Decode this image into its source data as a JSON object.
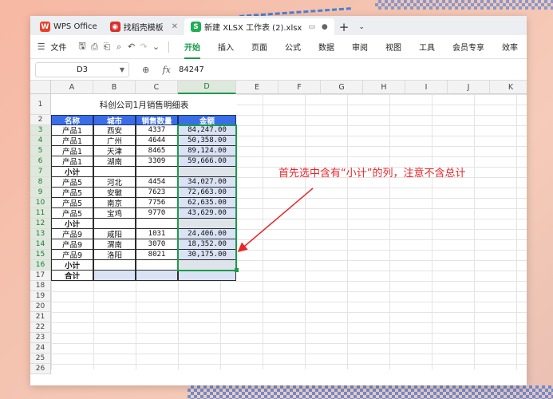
{
  "tabs": [
    {
      "label": "WPS Office",
      "icon": "wps-logo-icon"
    },
    {
      "label": "找稻壳模板",
      "icon": "docer-icon"
    },
    {
      "label": "新建 XLSX 工作表 (2).xlsx",
      "icon": "spreadsheet-s-icon",
      "active": true
    }
  ],
  "file_menu": "文件",
  "menus": [
    "开始",
    "插入",
    "页面",
    "公式",
    "数据",
    "审阅",
    "视图",
    "工具",
    "会员专享",
    "效率"
  ],
  "active_menu": "开始",
  "name_box": "D3",
  "formula_value": "84247",
  "columns": [
    "A",
    "B",
    "C",
    "D",
    "E",
    "F",
    "G",
    "H",
    "I",
    "J",
    "K"
  ],
  "rows": [
    "1",
    "2",
    "3",
    "4",
    "5",
    "6",
    "7",
    "8",
    "9",
    "10",
    "11",
    "12",
    "13",
    "14",
    "15",
    "16",
    "17",
    "18",
    "19",
    "20",
    "21",
    "22",
    "23",
    "24",
    "25",
    "26"
  ],
  "sheet": {
    "title": "科创公司1月销售明细表",
    "headers": [
      "名称",
      "城市",
      "销售数量",
      "金额"
    ],
    "rows": [
      [
        "产品1",
        "西安",
        "4337",
        "84,247.00"
      ],
      [
        "产品1",
        "广州",
        "4644",
        "50,358.00"
      ],
      [
        "产品1",
        "天津",
        "8465",
        "89,124.00"
      ],
      [
        "产品1",
        "湖南",
        "3309",
        "59,666.00"
      ],
      [
        "小计",
        "",
        "",
        ""
      ],
      [
        "产品5",
        "河北",
        "4454",
        "34,027.00"
      ],
      [
        "产品5",
        "安徽",
        "7623",
        "72,663.00"
      ],
      [
        "产品5",
        "南京",
        "7756",
        "62,635.00"
      ],
      [
        "产品5",
        "宝鸡",
        "9770",
        "43,629.00"
      ],
      [
        "小计",
        "",
        "",
        ""
      ],
      [
        "产品9",
        "咸阳",
        "1031",
        "24,406.00"
      ],
      [
        "产品9",
        "渭南",
        "3070",
        "18,352.00"
      ],
      [
        "产品9",
        "洛阳",
        "8021",
        "30,175.00"
      ],
      [
        "小计",
        "",
        "",
        ""
      ],
      [
        "合计",
        "",
        "",
        ""
      ]
    ]
  },
  "annotation": "首先选中含有“小计”的列，注意不含总计",
  "colors": {
    "header_bg": "#3a6ee8",
    "selection": "#1a9c4a",
    "annotation": "#e8262a",
    "alt_row": "#dae3f5"
  }
}
